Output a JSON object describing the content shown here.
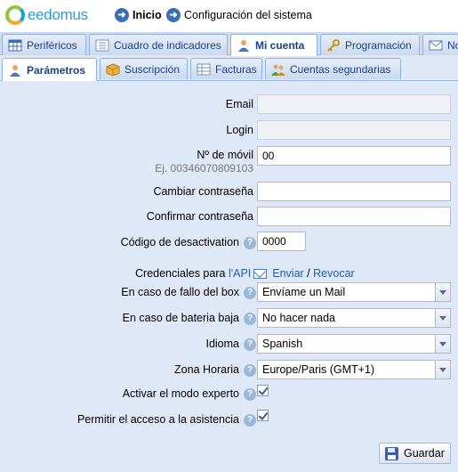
{
  "header": {
    "logo_text": "eedomus",
    "home_label": "Inicio",
    "config_label": "Configuración del sistema"
  },
  "tabs": [
    {
      "label": "Periféricos",
      "icon": "table-icon"
    },
    {
      "label": "Cuadro de indicadores",
      "icon": "dashboard-icon"
    },
    {
      "label": "Mi cuenta",
      "icon": "user-icon",
      "active": true
    },
    {
      "label": "Programación",
      "icon": "key-icon"
    },
    {
      "label": "No",
      "icon": "mail-icon"
    }
  ],
  "subtabs": [
    {
      "label": "Parámetros",
      "icon": "user-icon",
      "active": true
    },
    {
      "label": "Suscripción",
      "icon": "box-icon"
    },
    {
      "label": "Facturas",
      "icon": "table-icon"
    },
    {
      "label": "Cuentas segundarias",
      "icon": "users-icon"
    }
  ],
  "form": {
    "email": {
      "label": "Email",
      "value": ""
    },
    "login": {
      "label": "Login",
      "value": ""
    },
    "mobile": {
      "label": "Nº de móvil",
      "value": "00",
      "hint": "Ej. 0034607080910​3"
    },
    "change_password": {
      "label": "Cambiar contraseña",
      "value": ""
    },
    "confirm_password": {
      "label": "Confirmar contraseña",
      "value": ""
    },
    "deactivation_code": {
      "label": "Código de desactivation",
      "value": "0000"
    },
    "credentials": {
      "prefix": "Credenciales para",
      "api_link": "l'API",
      "send_link": "Enviar",
      "separator": "/",
      "revoke_link": "Revocar"
    },
    "box_failure": {
      "label": "En caso de fallo del box",
      "value": "Envíame un Mail"
    },
    "low_battery": {
      "label": "En caso de bateria baja",
      "value": "No hacer nada"
    },
    "language": {
      "label": "Idioma",
      "value": "Spanish"
    },
    "timezone": {
      "label": "Zona Horaria",
      "value": "Europe/Paris (GMT+1)"
    },
    "expert_mode": {
      "label": "Activar el modo experto",
      "checked": true
    },
    "assistance_access": {
      "label": "Permitir el acceso a la asistencia",
      "checked": true
    },
    "save_label": "Guardar"
  },
  "colors": {
    "accent": "#15428b",
    "panel_bg": "#dfe8f6",
    "link": "#1f5fa8"
  }
}
